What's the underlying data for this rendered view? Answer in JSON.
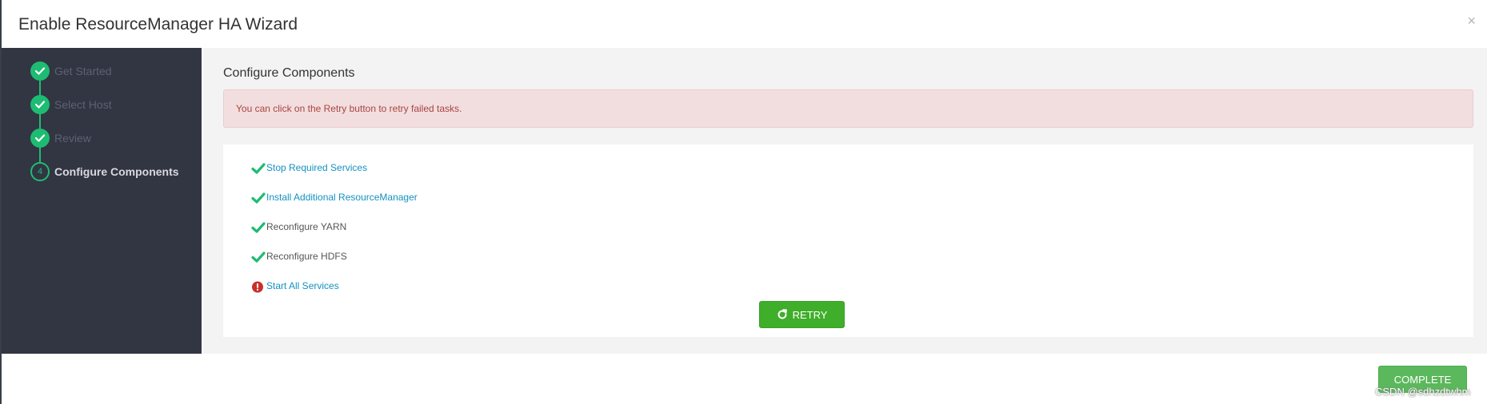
{
  "header": {
    "title": "Enable ResourceManager HA Wizard",
    "close_icon": "close-icon",
    "close_glyph": "×"
  },
  "sidebar": {
    "steps": [
      {
        "label": "Get Started",
        "state": "done",
        "icon": "check-icon"
      },
      {
        "label": "Select Host",
        "state": "done",
        "icon": "check-icon"
      },
      {
        "label": "Review",
        "state": "done",
        "icon": "check-icon"
      },
      {
        "label": "Configure Components",
        "state": "current",
        "number": "4"
      }
    ]
  },
  "main": {
    "title": "Configure Components",
    "alert": "You can click on the Retry button to retry failed tasks.",
    "tasks": [
      {
        "label": "Stop Required Services",
        "status": "completed",
        "link": true,
        "icon": "check-icon"
      },
      {
        "label": "Install Additional ResourceManager",
        "status": "completed",
        "link": true,
        "icon": "check-icon"
      },
      {
        "label": "Reconfigure YARN",
        "status": "completed",
        "link": false,
        "icon": "check-icon"
      },
      {
        "label": "Reconfigure HDFS",
        "status": "completed",
        "link": false,
        "icon": "check-icon"
      },
      {
        "label": "Start All Services",
        "status": "failed",
        "link": true,
        "icon": "error-icon"
      }
    ],
    "retry_label": "RETRY",
    "retry_icon": "refresh-icon"
  },
  "footer": {
    "complete_label": "COMPLETE"
  },
  "watermark": "CSDN @sdhzdtwhm",
  "colors": {
    "success_green": "#1ebc72",
    "retry_green": "#3fae2a",
    "complete_green": "#5cb85c",
    "sidebar_bg": "#323542",
    "alert_bg": "#f2dede",
    "alert_text": "#a94442",
    "link": "#1491c1",
    "error_red": "#c9302c"
  }
}
